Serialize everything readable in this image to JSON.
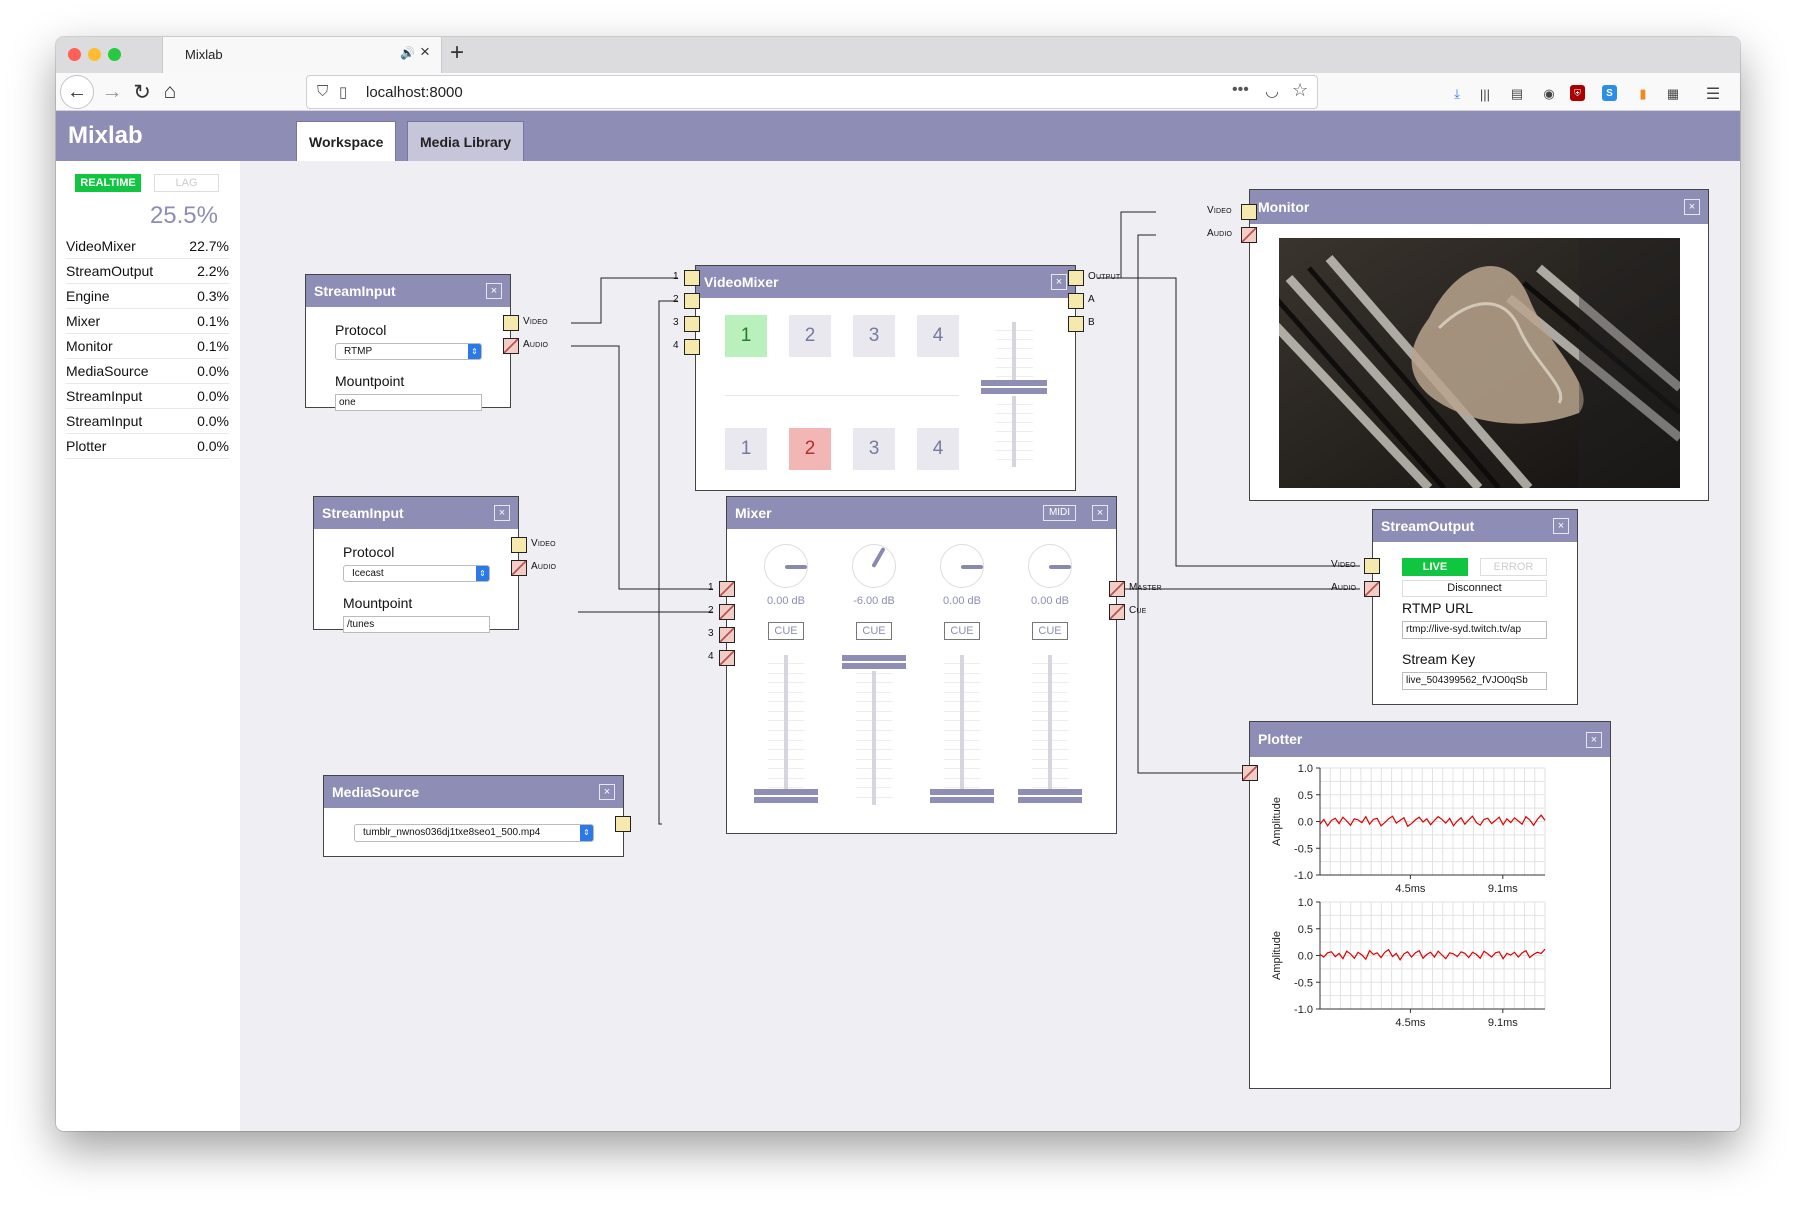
{
  "browser": {
    "tab_title": "Mixlab",
    "url": "localhost:8000",
    "icons": [
      "back-arrow",
      "forward-arrow",
      "reload",
      "home",
      "shield",
      "page-info",
      "more-dots",
      "pocket",
      "star",
      "download",
      "library",
      "sidebar",
      "account",
      "ublock",
      "skype",
      "tampermonkey",
      "extensions",
      "menu"
    ]
  },
  "app": {
    "brand": "Mixlab",
    "tabs": [
      {
        "label": "Workspace",
        "active": true
      },
      {
        "label": "Media Library",
        "active": false
      }
    ]
  },
  "sidebar": {
    "realtime_label": "REALTIME",
    "lag_label": "LAG",
    "total_load": "25.5%",
    "stats": [
      {
        "name": "VideoMixer",
        "value": "22.7%"
      },
      {
        "name": "StreamOutput",
        "value": "2.2%"
      },
      {
        "name": "Engine",
        "value": "0.3%"
      },
      {
        "name": "Mixer",
        "value": "0.1%"
      },
      {
        "name": "Monitor",
        "value": "0.1%"
      },
      {
        "name": "MediaSource",
        "value": "0.0%"
      },
      {
        "name": "StreamInput",
        "value": "0.0%"
      },
      {
        "name": "StreamInput",
        "value": "0.0%"
      },
      {
        "name": "Plotter",
        "value": "0.0%"
      }
    ]
  },
  "nodes": {
    "stream_input_1": {
      "title": "StreamInput",
      "close": "×",
      "protocol_label": "Protocol",
      "protocol_value": "RTMP",
      "mountpoint_label": "Mountpoint",
      "mountpoint_value": "one",
      "ports": {
        "video": "Video",
        "audio": "Audio"
      }
    },
    "stream_input_2": {
      "title": "StreamInput",
      "close": "×",
      "protocol_label": "Protocol",
      "protocol_value": "Icecast",
      "mountpoint_label": "Mountpoint",
      "mountpoint_value": "/tunes",
      "ports": {
        "video": "Video",
        "audio": "Audio"
      }
    },
    "media_source": {
      "title": "MediaSource",
      "close": "×",
      "file_value": "tumblr_nwnos036dj1txe8seo1_500.mp4"
    },
    "video_mixer": {
      "title": "VideoMixer",
      "close": "×",
      "inputs": [
        "1",
        "2",
        "3",
        "4"
      ],
      "bank_a": [
        "1",
        "2",
        "3",
        "4"
      ],
      "bank_b": [
        "1",
        "2",
        "3",
        "4"
      ],
      "bank_a_selected": "1",
      "bank_b_selected": "2",
      "crossfade": 0.55,
      "outputs": {
        "output": "Output",
        "a": "A",
        "b": "B"
      }
    },
    "mixer": {
      "title": "Mixer",
      "midi": "MIDI",
      "close": "×",
      "inputs": [
        "1",
        "2",
        "3",
        "4"
      ],
      "channels": [
        {
          "db": "0.00 dB",
          "cue": "CUE",
          "level": 0.0
        },
        {
          "db": "-6.00 dB",
          "cue": "CUE",
          "level": 1.0
        },
        {
          "db": "0.00 dB",
          "cue": "CUE",
          "level": 0.0
        },
        {
          "db": "0.00 dB",
          "cue": "CUE",
          "level": 0.0
        }
      ],
      "outputs": {
        "master": "Master",
        "cue": "Cue"
      }
    },
    "monitor": {
      "title": "Monitor",
      "close": "×",
      "ports": {
        "video": "Video",
        "audio": "Audio"
      }
    },
    "stream_output": {
      "title": "StreamOutput",
      "close": "×",
      "live_label": "LIVE",
      "error_label": "ERROR",
      "disconnect_label": "Disconnect",
      "rtmp_label": "RTMP URL",
      "rtmp_value": "rtmp://live-syd.twitch.tv/ap",
      "key_label": "Stream Key",
      "key_value": "live_504399562_fVJO0qSb",
      "ports": {
        "video": "Video",
        "audio": "Audio"
      }
    },
    "plotter": {
      "title": "Plotter",
      "close": "×"
    }
  },
  "chart_data": [
    {
      "type": "line",
      "ylabel": "Amplitude",
      "ylim": [
        -1.0,
        1.0
      ],
      "yticks": [
        "1.0",
        "0.5",
        "0.0",
        "-0.5",
        "-1.0"
      ],
      "xticks": [
        "4.5ms",
        "9.1ms"
      ],
      "xrange_ms": [
        0,
        11.2
      ],
      "series_color": "#e00000",
      "values": [
        -0.05,
        0.04,
        -0.08,
        0.02,
        0.06,
        -0.04,
        0.08,
        0.01,
        -0.07,
        0.05,
        0.03,
        -0.02,
        0.09,
        -0.05,
        0.04,
        0.06,
        -0.08,
        -0.02,
        0.05,
        0.1,
        -0.03,
        0.02,
        0.07,
        -0.09,
        -0.04,
        0.03,
        0.08,
        -0.01,
        0.05,
        -0.06,
        0.02,
        0.09,
        0.04,
        -0.03,
        0.06,
        -0.08,
        0.01,
        0.07,
        -0.05,
        0.03,
        0.1,
        -0.02,
        -0.07,
        0.04,
        0.06,
        -0.04,
        0.02,
        0.08,
        -0.06,
        0.05,
        -0.02,
        0.07,
        0.01,
        -0.05,
        0.09,
        0.03,
        -0.07,
        0.04,
        0.12,
        0.02
      ]
    },
    {
      "type": "line",
      "ylabel": "Amplitude",
      "ylim": [
        -1.0,
        1.0
      ],
      "yticks": [
        "1.0",
        "0.5",
        "0.0",
        "-0.5",
        "-1.0"
      ],
      "xticks": [
        "4.5ms",
        "9.1ms"
      ],
      "xrange_ms": [
        0,
        11.2
      ],
      "series_color": "#e00000",
      "values": [
        0.02,
        -0.03,
        0.05,
        0.07,
        -0.02,
        0.04,
        -0.06,
        0.08,
        0.03,
        -0.05,
        0.06,
        0.01,
        -0.07,
        0.09,
        0.02,
        0.05,
        -0.04,
        0.06,
        0.11,
        -0.02,
        0.04,
        -0.08,
        0.03,
        0.07,
        -0.03,
        0.05,
        0.09,
        -0.05,
        0.02,
        0.06,
        -0.03,
        0.08,
        0.01,
        -0.06,
        0.05,
        0.03,
        -0.02,
        0.07,
        0.04,
        -0.04,
        0.06,
        0.02,
        -0.05,
        0.08,
        0.03,
        -0.03,
        0.05,
        0.07,
        -0.06,
        0.04,
        0.01,
        0.06,
        -0.03,
        0.05,
        0.09,
        -0.04,
        0.02,
        0.06,
        0.04,
        0.12
      ]
    }
  ]
}
